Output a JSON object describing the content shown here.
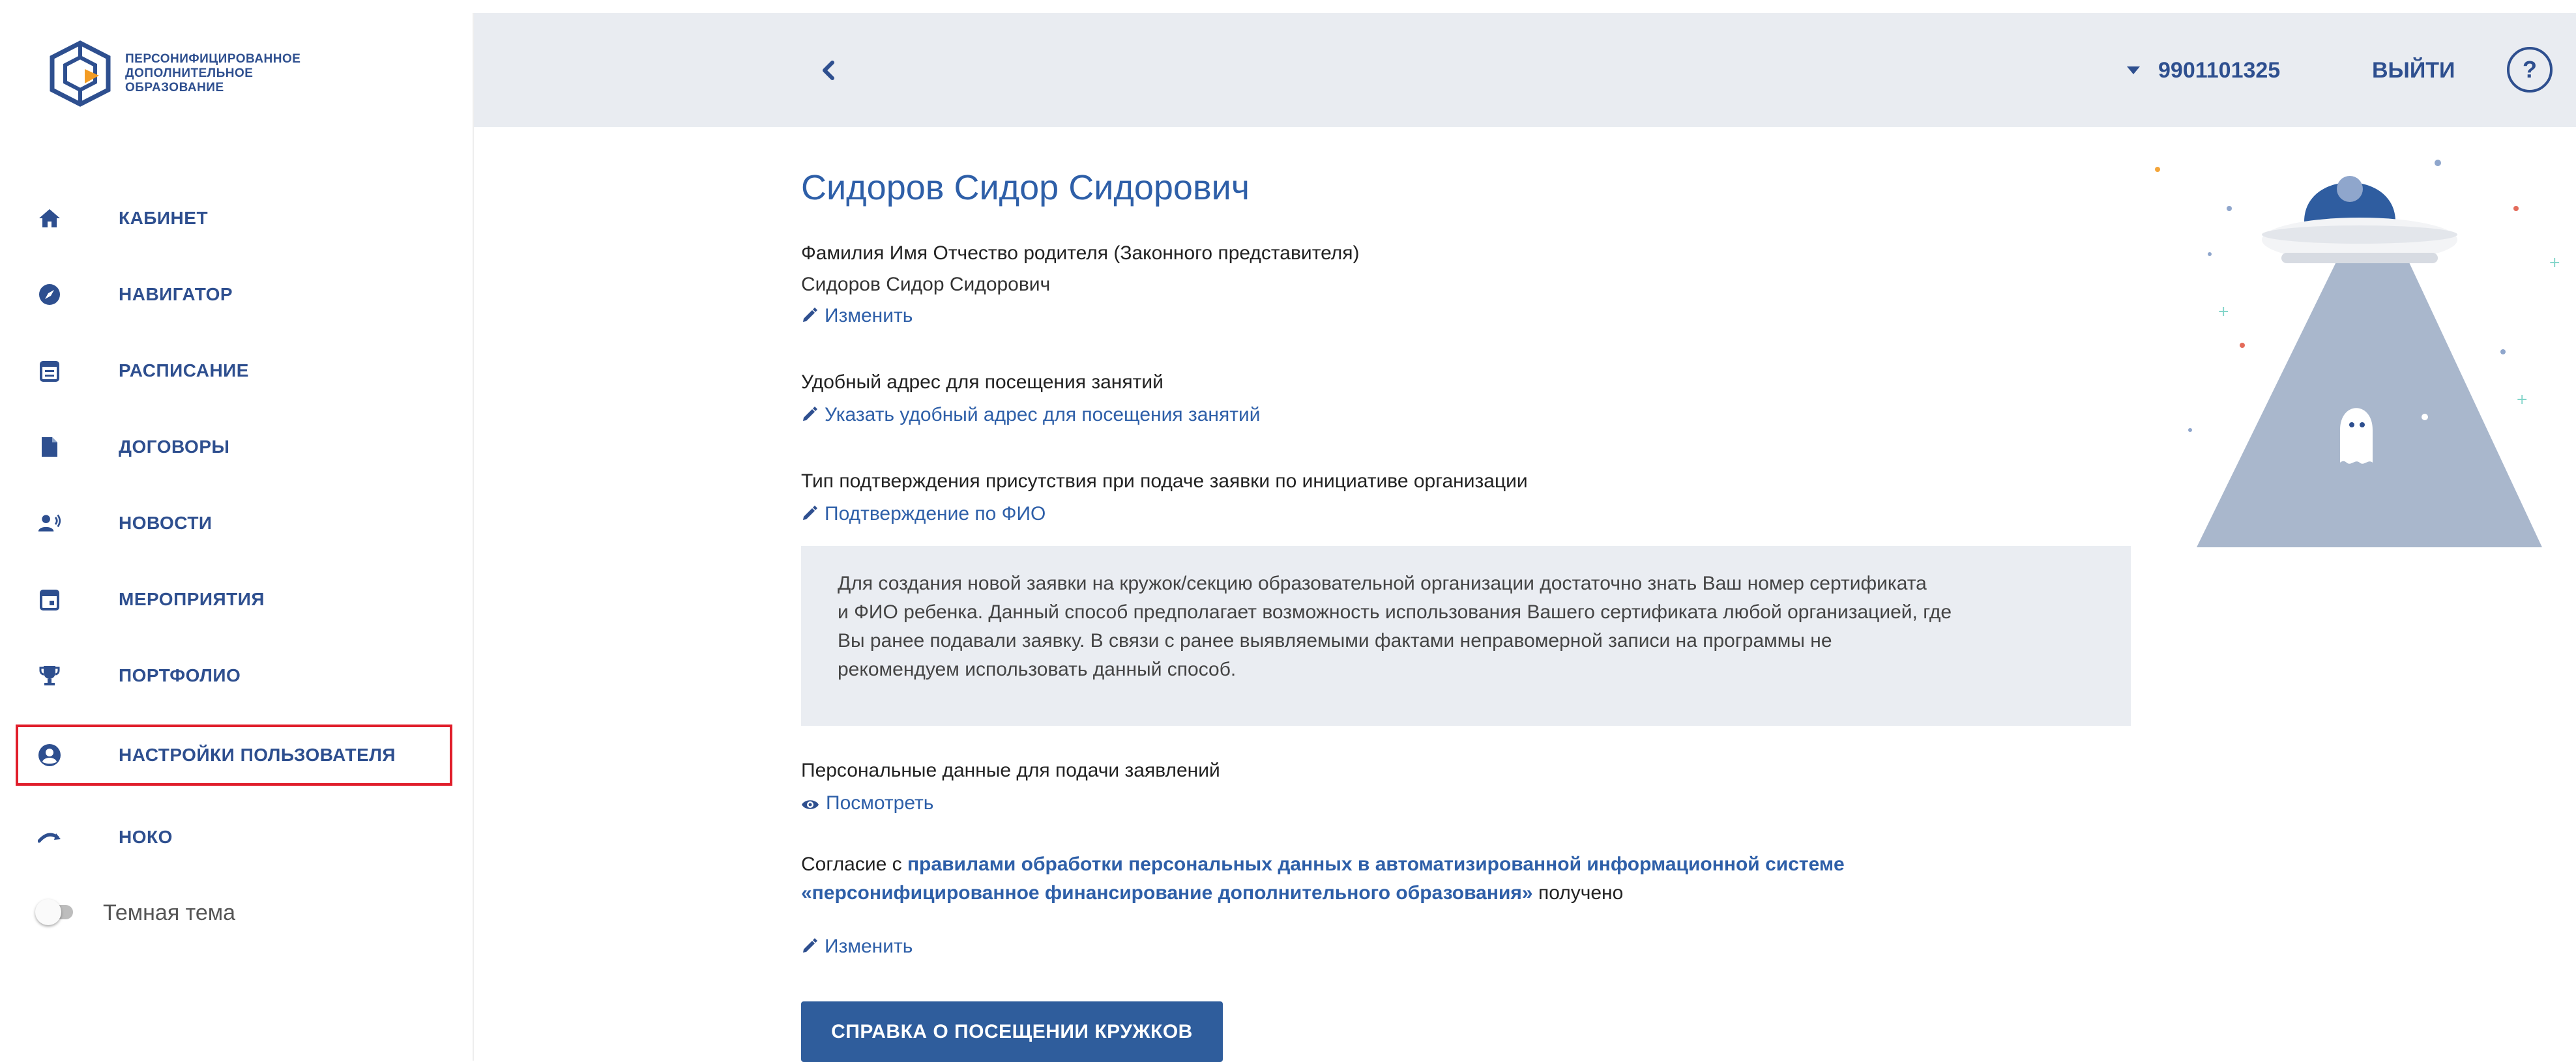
{
  "app": {
    "logo_text": [
      "ПЕРСОНИФИЦИРОВАННОЕ",
      "ДОПОЛНИТЕЛЬНОЕ",
      "ОБРАЗОВАНИЕ"
    ]
  },
  "sidebar": {
    "items": [
      {
        "label": "КАБИНЕТ",
        "icon": "home-icon"
      },
      {
        "label": "НАВИГАТОР",
        "icon": "compass-icon"
      },
      {
        "label": "РАСПИСАНИЕ",
        "icon": "schedule-icon"
      },
      {
        "label": "ДОГОВОРЫ",
        "icon": "document-icon"
      },
      {
        "label": "НОВОСТИ",
        "icon": "news-icon"
      },
      {
        "label": "МЕРОПРИЯТИЯ",
        "icon": "calendar-icon"
      },
      {
        "label": "ПОРТФОЛИО",
        "icon": "trophy-icon"
      },
      {
        "label": "НАСТРОЙКИ ПОЛЬЗОВАТЕЛЯ",
        "icon": "user-circle-icon",
        "active": true
      },
      {
        "label": "НОКО",
        "icon": "trend-icon"
      }
    ],
    "theme_toggle_label": "Темная тема",
    "theme_toggle_on": false
  },
  "topbar": {
    "user_id": "9901101325",
    "logout_label": "ВЫЙТИ",
    "help_label": "?"
  },
  "main": {
    "user_name": "Сидоров Сидор Сидорович",
    "parent_label": "Фамилия Имя Отчество родителя (Законного представителя)",
    "parent_value": "Сидоров Сидор Сидорович",
    "edit_parent_link": "Изменить",
    "address_label": "Удобный адрес для посещения занятий",
    "address_link": "Указать удобный адрес для посещения занятий",
    "confirm_label": "Тип подтверждения присутствия при подаче заявки по инициативе организации",
    "confirm_link": "Подтверждение по ФИО",
    "info_lines": [
      "Для создания новой заявки на кружок/секцию образовательной организации достаточно знать Ваш номер сертификата",
      "и ФИО ребенка. Данный способ предполагает возможность использования Вашего сертификата любой организацией, где",
      "Вы ранее подавали заявку. В связи с ранее выявляемыми фактами неправомерной записи на программы не",
      "рекомендуем использовать данный способ."
    ],
    "personal_label": "Персональные данные для подачи заявлений",
    "personal_link": "Посмотреть",
    "consent_prefix": "Согласие с ",
    "consent_link_1": "правилами обработки персональных данных в автоматизированной информационной системе",
    "consent_link_2": "«персонифицированное финансирование дополнительного образования»",
    "consent_suffix": " получено",
    "edit_consent_link": "Изменить",
    "report_button": "СПРАВКА О ПОСЕЩЕНИИ КРУЖКОВ"
  },
  "colors": {
    "brand_blue": "#2e4f8f",
    "link_blue": "#2e5fa8",
    "button_blue": "#2f5d9c",
    "highlight_red": "#e01e2b",
    "topbar_bg": "#e9ecf1",
    "info_bg": "#eaedf2"
  }
}
